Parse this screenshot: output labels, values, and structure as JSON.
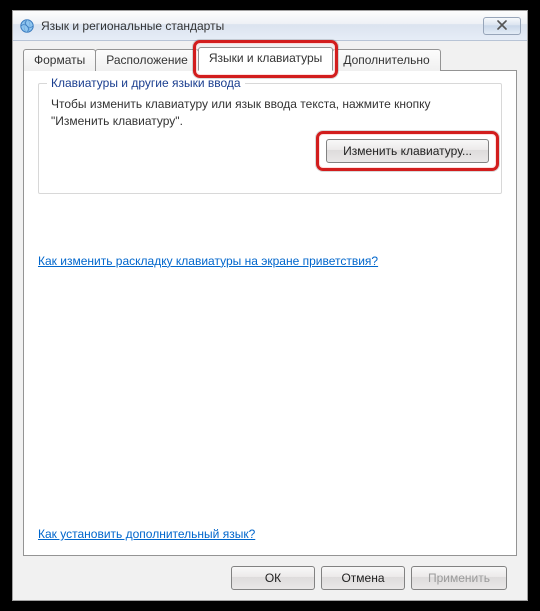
{
  "window": {
    "title": "Язык и региональные стандарты"
  },
  "tabs": {
    "t0": "Форматы",
    "t1": "Расположение",
    "t2": "Языки и клавиатуры",
    "t3": "Дополнительно"
  },
  "group": {
    "legend": "Клавиатуры и другие языки ввода",
    "body": "Чтобы изменить клавиатуру или язык ввода текста, нажмите кнопку \"Изменить клавиатуру\".",
    "change_label": "Изменить клавиатуру..."
  },
  "links": {
    "welcome": "Как изменить раскладку клавиатуры на экране приветствия?",
    "addlang": "Как установить дополнительный язык?"
  },
  "buttons": {
    "ok": "ОК",
    "cancel": "Отмена",
    "apply": "Применить"
  }
}
